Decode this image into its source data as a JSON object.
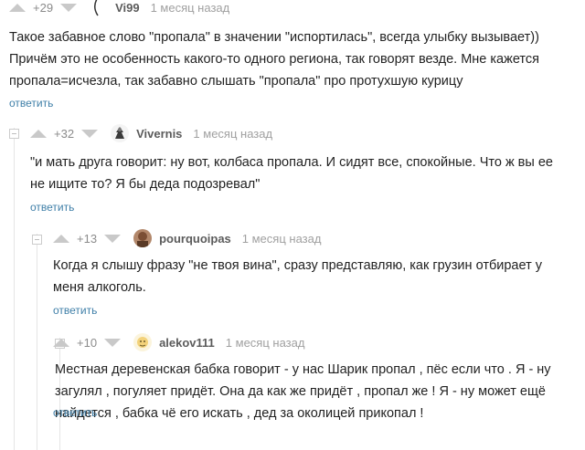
{
  "comments": [
    {
      "rating": "+29",
      "author": "Vi99",
      "time": "1 месяц назад",
      "text": "Такое забавное слово \"пропала\" в значении \"испортилась\", всегда улыбку вызывает)) Причём это не особенность какого-то одного региона, так говорят везде. Мне кажется пропала=исчезла, так забавно слышать \"пропала\" про протухшую курицу",
      "reply": "ответить"
    },
    {
      "rating": "+32",
      "author": "Vivernis",
      "time": "1 месяц назад",
      "text": "\"и мать друга говорит: ну вот, колбаса пропала. И сидят все, спокойные. Что ж вы ее не ищите то? Я бы деда подозревал\"",
      "reply": "ответить"
    },
    {
      "rating": "+13",
      "author": "pourquoipas",
      "time": "1 месяц назад",
      "text": "Когда я слышу фразу \"не твоя вина\", сразу представляю, как грузин отбирает у меня алкоголь.",
      "reply": "ответить"
    },
    {
      "rating": "+10",
      "author": "alekov111",
      "time": "1 месяц назад",
      "text": "Местная деревенская бабка говорит - у нас Шарик пропал , пёс если что . Я - ну загулял , погуляет придёт. Она да как же придёт , пропал же ! Я - ну может ещё найдется , бабка чё его искать , дед за околицей прикопал !",
      "reply": "ответить"
    }
  ]
}
